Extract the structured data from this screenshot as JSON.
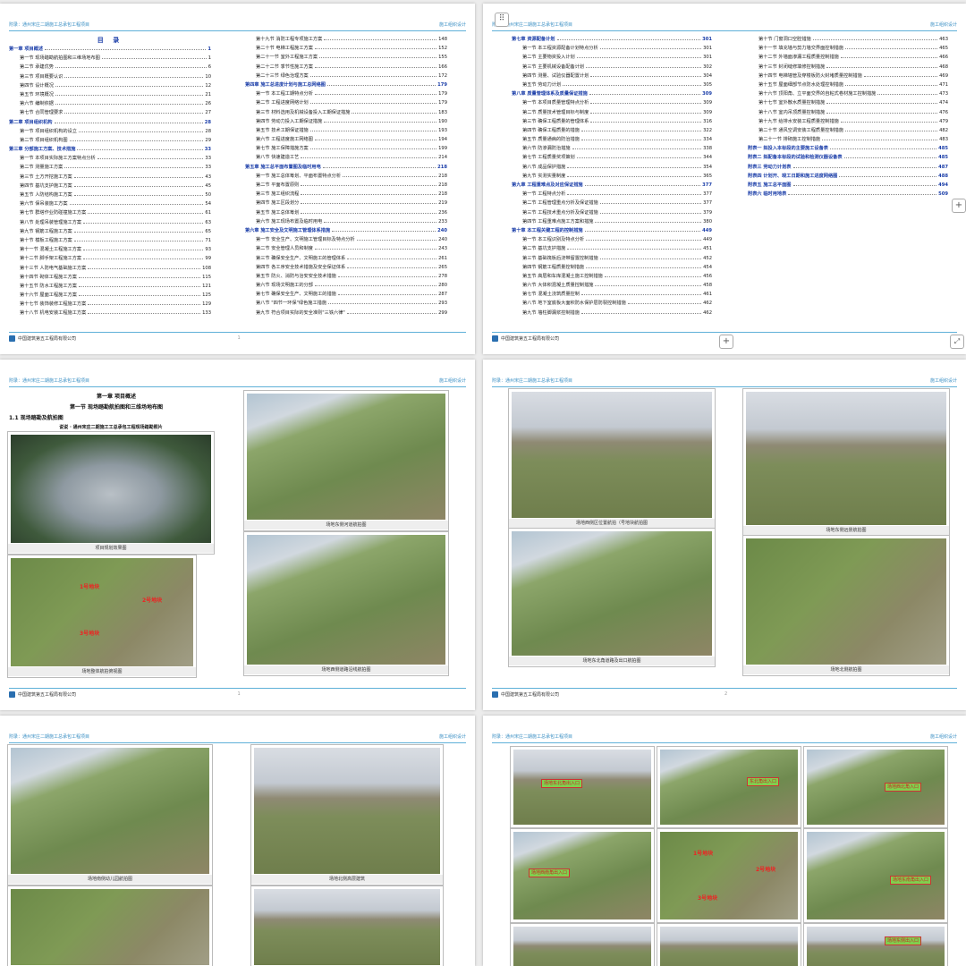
{
  "header": {
    "left": "附录：通州宋庄二期施工总承包工程项目",
    "right": "施工组织设计"
  },
  "footer": {
    "company": "中国建筑第五工程局有限公司"
  },
  "toc1": {
    "title": "目 录",
    "col1": [
      {
        "t": "第一章 项目概述",
        "n": "1",
        "ch": true
      },
      {
        "t": "第一节 现场踏勘航拍图和三维场地布图",
        "n": "1"
      },
      {
        "t": "第二节 承建优势",
        "n": "6"
      },
      {
        "t": "第三节 项目概要认识",
        "n": "10"
      },
      {
        "t": "第四节 设计概况",
        "n": "12"
      },
      {
        "t": "第五节 环境概况",
        "n": "21"
      },
      {
        "t": "第六节 编制依据",
        "n": "26"
      },
      {
        "t": "第七节 合同管理要求",
        "n": "27"
      },
      {
        "t": "第二章 项目组织机构",
        "n": "28",
        "ch": true
      },
      {
        "t": "第一节 项目组织机构的设立",
        "n": "28"
      },
      {
        "t": "第二节 项目组织机构图",
        "n": "29"
      },
      {
        "t": "第三章 分部施工方案、技术措施",
        "n": "33",
        "ch": true
      },
      {
        "t": "第一节 本项目实际施工方案特点分析",
        "n": "33"
      },
      {
        "t": "第二节 测量施工方案",
        "n": "33"
      },
      {
        "t": "第三节 土方开挖施工方案",
        "n": "43"
      },
      {
        "t": "第四节 基坑支护施工方案",
        "n": "45"
      },
      {
        "t": "第五节 人防结构施工方案",
        "n": "50"
      },
      {
        "t": "第六节 保吊装施工方案",
        "n": "54"
      },
      {
        "t": "第七节 群塔作业防碰撞施工方案",
        "n": "61"
      },
      {
        "t": "第八节 处理吊装管理施工方案",
        "n": "63"
      },
      {
        "t": "第九节 钢筋工程施工方案",
        "n": "65"
      },
      {
        "t": "第十节 模板工程施工方案",
        "n": "71"
      },
      {
        "t": "第十一节 混凝土工程施工方案",
        "n": "93"
      },
      {
        "t": "第十二节 脚手架工程施工方案",
        "n": "99"
      },
      {
        "t": "第十三节 人防电气基础施工方案",
        "n": "108"
      },
      {
        "t": "第十四节 砌体工程施工方案",
        "n": "115"
      },
      {
        "t": "第十五节 防水工程施工方案",
        "n": "121"
      },
      {
        "t": "第十六节 屋面工程施工方案",
        "n": "125"
      },
      {
        "t": "第十七节 装饰装修工程施工方案",
        "n": "129"
      },
      {
        "t": "第十八节 机电安装工程施工方案",
        "n": "133"
      }
    ],
    "col2": [
      {
        "t": "第十九节 消防工程专项施工方案",
        "n": "148"
      },
      {
        "t": "第二十节 电梯工程施工方案",
        "n": "152"
      },
      {
        "t": "第二十一节 室外工程施工方案",
        "n": "155"
      },
      {
        "t": "第二十二节 季节性施工方案",
        "n": "166"
      },
      {
        "t": "第二十三节 绿色治理方案",
        "n": "172"
      },
      {
        "t": "第四章 施工总进度计划与施工总网络图",
        "n": "179",
        "ch": true
      },
      {
        "t": "第一节 本工程工期特点分析",
        "n": "179"
      },
      {
        "t": "第二节 工程进度网络计划",
        "n": "179"
      },
      {
        "t": "第三节 材料选用及机械设备投入工期保证措施",
        "n": "183"
      },
      {
        "t": "第四节 劳动力投入工期保证措施",
        "n": "190"
      },
      {
        "t": "第五节 技术工期保证措施",
        "n": "193"
      },
      {
        "t": "第六节 工程进度施工网络图",
        "n": "194"
      },
      {
        "t": "第七节 施工保障措施方案",
        "n": "199"
      },
      {
        "t": "第八节 快速建造工艺",
        "n": "214"
      },
      {
        "t": "第五章 施工总平面布置图及临时用电",
        "n": "218",
        "ch": true
      },
      {
        "t": "第一节 施工总体筹划、平面布置特点分析",
        "n": "218"
      },
      {
        "t": "第二节 平面布置原则",
        "n": "218"
      },
      {
        "t": "第三节 施工组织流程",
        "n": "218"
      },
      {
        "t": "第四节 施工区段划分",
        "n": "219"
      },
      {
        "t": "第五节 施工总体筹划",
        "n": "236"
      },
      {
        "t": "第六节 施工现场布置及临时用电",
        "n": "233"
      },
      {
        "t": "第六章 施工安全及文明施工管理体系措施",
        "n": "240",
        "ch": true
      },
      {
        "t": "第一节 安全生产、文明施工管理目标及特点分析",
        "n": "240"
      },
      {
        "t": "第二节 安全管理人员和制度",
        "n": "243"
      },
      {
        "t": "第三节 确保安全生产、文明施工的管理体系",
        "n": "261"
      },
      {
        "t": "第四节 各工序安全技术措施及安全保证体系",
        "n": "265"
      },
      {
        "t": "第五节 防火、消防与治安安全技术措施",
        "n": "278"
      },
      {
        "t": "第六节 现场文明施工的分部",
        "n": "280"
      },
      {
        "t": "第七节 确保安全生产、文明施工的措施",
        "n": "287"
      },
      {
        "t": "第八节 \"四节一环保\"绿色施工措施",
        "n": "293"
      },
      {
        "t": "第九节 符合项目实际的安全准则\"三铁六律\"",
        "n": "299"
      }
    ],
    "page_no": "1"
  },
  "toc2": {
    "col1": [
      {
        "t": "第七章 资源配备计划",
        "n": "301",
        "ch": true
      },
      {
        "t": "第一节 本工程资源配备计划特点分析",
        "n": "301"
      },
      {
        "t": "第二节 主要物资投入计划",
        "n": "301"
      },
      {
        "t": "第三节 主要机械设备配备计划",
        "n": "302"
      },
      {
        "t": "第四节 测量、试验仪器配置计划",
        "n": "304"
      },
      {
        "t": "第五节 劳动力计划",
        "n": "305"
      },
      {
        "t": "第八章 质量管理体系及质量保证措施",
        "n": "309",
        "ch": true
      },
      {
        "t": "第一节 本项目质量管理特点分析",
        "n": "309"
      },
      {
        "t": "第二节 质量技术管理目标与制度",
        "n": "309"
      },
      {
        "t": "第三节 确保工程质量的管理体系",
        "n": "316"
      },
      {
        "t": "第四节 确保工程质量的措施",
        "n": "322"
      },
      {
        "t": "第五节 质量通病的防治措施",
        "n": "334"
      },
      {
        "t": "第六节 防渗漏防治措施",
        "n": "338"
      },
      {
        "t": "第七节 工程质量奖项策划",
        "n": "344"
      },
      {
        "t": "第八节 成品保护措施",
        "n": "354"
      },
      {
        "t": "第九节 实测实量制度",
        "n": "365"
      },
      {
        "t": "第九章 工程重难点及对应保证措施",
        "n": "377",
        "ch": true
      },
      {
        "t": "第一节 工程特点分析",
        "n": "377"
      },
      {
        "t": "第二节 工程管理重点分析及保证措施",
        "n": "377"
      },
      {
        "t": "第三节 工程技术重点分析及保证措施",
        "n": "379"
      },
      {
        "t": "第四节 工程重难点施工方案和措施",
        "n": "380"
      },
      {
        "t": "第十章 本工程关键工程的控制措施",
        "n": "449",
        "ch": true
      },
      {
        "t": "第一节 本工程识别及特点分析",
        "n": "449"
      },
      {
        "t": "第二节 基坑支护措施",
        "n": "451"
      },
      {
        "t": "第三节 基础筏板后浇带留置控制措施",
        "n": "452"
      },
      {
        "t": "第四节 钢筋工程质量控制措施",
        "n": "454"
      },
      {
        "t": "第五节 高层和车库混凝土施工控制措施",
        "n": "456"
      },
      {
        "t": "第六节 大体积混凝土质量控制措施",
        "n": "458"
      },
      {
        "t": "第七节 混凝土浇筑质量控制",
        "n": "461"
      },
      {
        "t": "第八节 地下室底板大面积防水保护层防裂控制措施",
        "n": "462"
      },
      {
        "t": "第九节 墙柱脚漏浆控制措施",
        "n": "462"
      }
    ],
    "col2": [
      {
        "t": "第十节 门窗洞口空腔措施",
        "n": "463"
      },
      {
        "t": "第十一节 填充墙与剪力墙交界面控制措施",
        "n": "465"
      },
      {
        "t": "第十二节 外墙面渗漏工程质量控制措施",
        "n": "466"
      },
      {
        "t": "第十三节 封闭缝修填修控制措施",
        "n": "468"
      },
      {
        "t": "第十四节 电梯墙管及穿楼板防火封堵质量控制措施",
        "n": "469"
      },
      {
        "t": "第十五节 屋面细部节点防水处理控制措施",
        "n": "471"
      },
      {
        "t": "第十六节 顶阳角、立平面交界的自粘式卷材施工控制措施",
        "n": "473"
      },
      {
        "t": "第十七节 室外散水质量控制措施",
        "n": "474"
      },
      {
        "t": "第十八节 室内吊顶质量控制措施",
        "n": "476"
      },
      {
        "t": "第十九节 给排水安装工程质量控制措施",
        "n": "479"
      },
      {
        "t": "第二十节 通风空调安装工程质量控制措施",
        "n": "482"
      },
      {
        "t": "第二十一节 排砌施工控制措施",
        "n": "483"
      },
      {
        "t": "附表一 拟投入本标段的主要施工设备表",
        "n": "485",
        "ch": true
      },
      {
        "t": "附表二 拟配备本标段的试验和检测仪器设备表",
        "n": "485",
        "ch": true
      },
      {
        "t": "附表三 劳动力计划表",
        "n": "487",
        "ch": true
      },
      {
        "t": "附表四 计划开、竣工日期和施工进度网络图",
        "n": "488",
        "ch": true
      },
      {
        "t": "附表五 施工总平面图",
        "n": "494",
        "ch": true
      },
      {
        "t": "附表六 临时用地表",
        "n": "509",
        "ch": true
      }
    ]
  },
  "page3": {
    "chapter": "第一章 项目概述",
    "section": "第一节 现场踏勘航拍图和三维场地布图",
    "subsection": "1.1 现场踏勘及航拍图",
    "figure_title": "说说 · 通州宋庄二期施工工总承包工程现场踏勘照片",
    "captions": [
      "项目规划效果图",
      "场地整体航拍俯视图",
      "场地东侧河道航拍图",
      "场地西侧道路沿线航拍图"
    ],
    "plot_labels": [
      "1号地块",
      "2号地块",
      "3号地块"
    ],
    "page_no": "1"
  },
  "page4": {
    "captions": [
      "场地西侧区位置航拍（号地块航拍图",
      "场地东侧远景航拍图",
      "场地东北角道路及出口航拍图",
      "场地北侧航拍图"
    ],
    "page_no": "2"
  },
  "page5": {
    "captions": [
      "场地南侧幼儿园航拍图",
      "场地北侧高层建筑"
    ]
  },
  "page6": {
    "labels": [
      "场地东北角出入口",
      "东北角出入口",
      "场地西北角入口",
      "场地西南角出入口",
      "场地东南角出入口",
      "场地东侧出入口"
    ],
    "plot_labels": [
      "1号地块",
      "2号地块",
      "3号地块"
    ]
  },
  "controls": {
    "grid_icon": "⠿",
    "plus": "+",
    "fit": "⤢"
  }
}
